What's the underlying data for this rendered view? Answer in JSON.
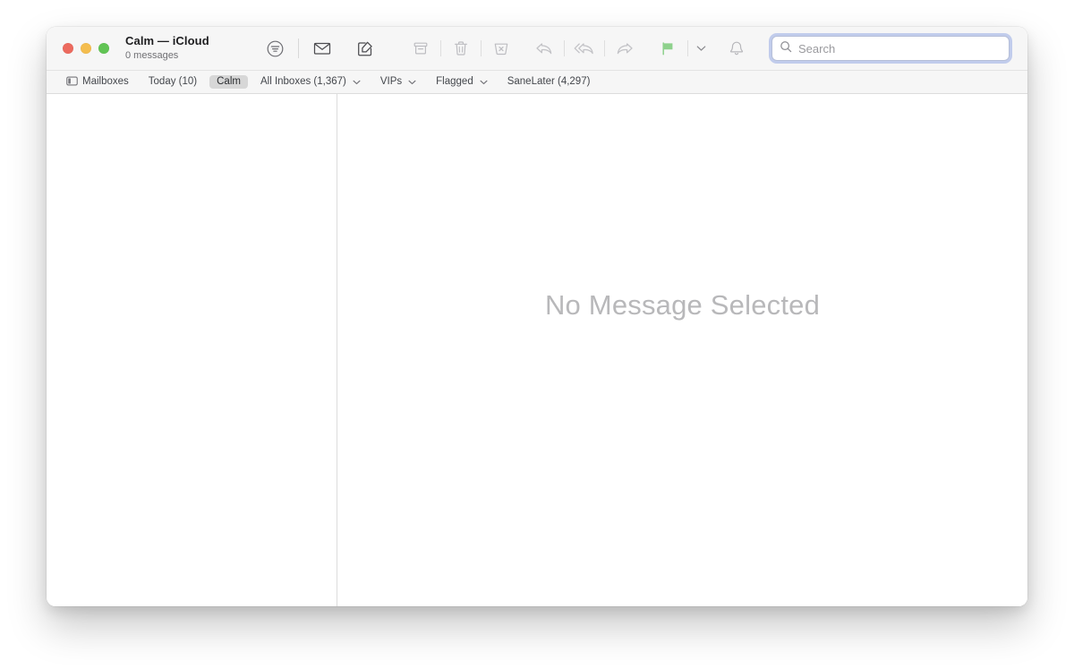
{
  "window": {
    "title": "Calm — iCloud",
    "subtitle": "0 messages",
    "traffic_lights": {
      "close_label": "close",
      "minimize_label": "minimize",
      "zoom_label": "zoom",
      "close_color": "#ec6a5e",
      "minimize_color": "#f4bd4e",
      "zoom_color": "#61c454"
    }
  },
  "toolbar": {
    "items": [
      {
        "name": "filter-icon",
        "label": "Filter"
      },
      {
        "name": "get-mail-icon",
        "label": "Get Mail"
      },
      {
        "name": "compose-icon",
        "label": "New Message"
      },
      {
        "name": "archive-icon",
        "label": "Archive"
      },
      {
        "name": "trash-icon",
        "label": "Delete"
      },
      {
        "name": "junk-icon",
        "label": "Move to Junk"
      },
      {
        "name": "reply-icon",
        "label": "Reply"
      },
      {
        "name": "reply-all-icon",
        "label": "Reply All"
      },
      {
        "name": "forward-icon",
        "label": "Forward"
      },
      {
        "name": "flag-icon",
        "label": "Flag"
      },
      {
        "name": "flag-chevron-icon",
        "label": "Flag options"
      },
      {
        "name": "mute-icon",
        "label": "Mute"
      }
    ],
    "flag_color": "#8ed18c"
  },
  "search": {
    "placeholder": "Search",
    "value": "",
    "focused": true,
    "focus_ring_color": "#6b8ade"
  },
  "favorites_bar": {
    "items": [
      {
        "label": "Mailboxes",
        "icon": "sidebar-toggle-icon",
        "chevron": false,
        "active": false
      },
      {
        "label": "Today (10)",
        "icon": null,
        "chevron": false,
        "active": false
      },
      {
        "label": "Calm",
        "icon": null,
        "chevron": false,
        "active": true
      },
      {
        "label": "All Inboxes (1,367)",
        "icon": null,
        "chevron": true,
        "active": false
      },
      {
        "label": "VIPs",
        "icon": null,
        "chevron": true,
        "active": false
      },
      {
        "label": "Flagged",
        "icon": null,
        "chevron": true,
        "active": false
      },
      {
        "label": "SaneLater (4,297)",
        "icon": null,
        "chevron": false,
        "active": false
      }
    ]
  },
  "message_list": {
    "items": [],
    "empty": true
  },
  "message_view": {
    "empty_text": "No Message Selected"
  }
}
